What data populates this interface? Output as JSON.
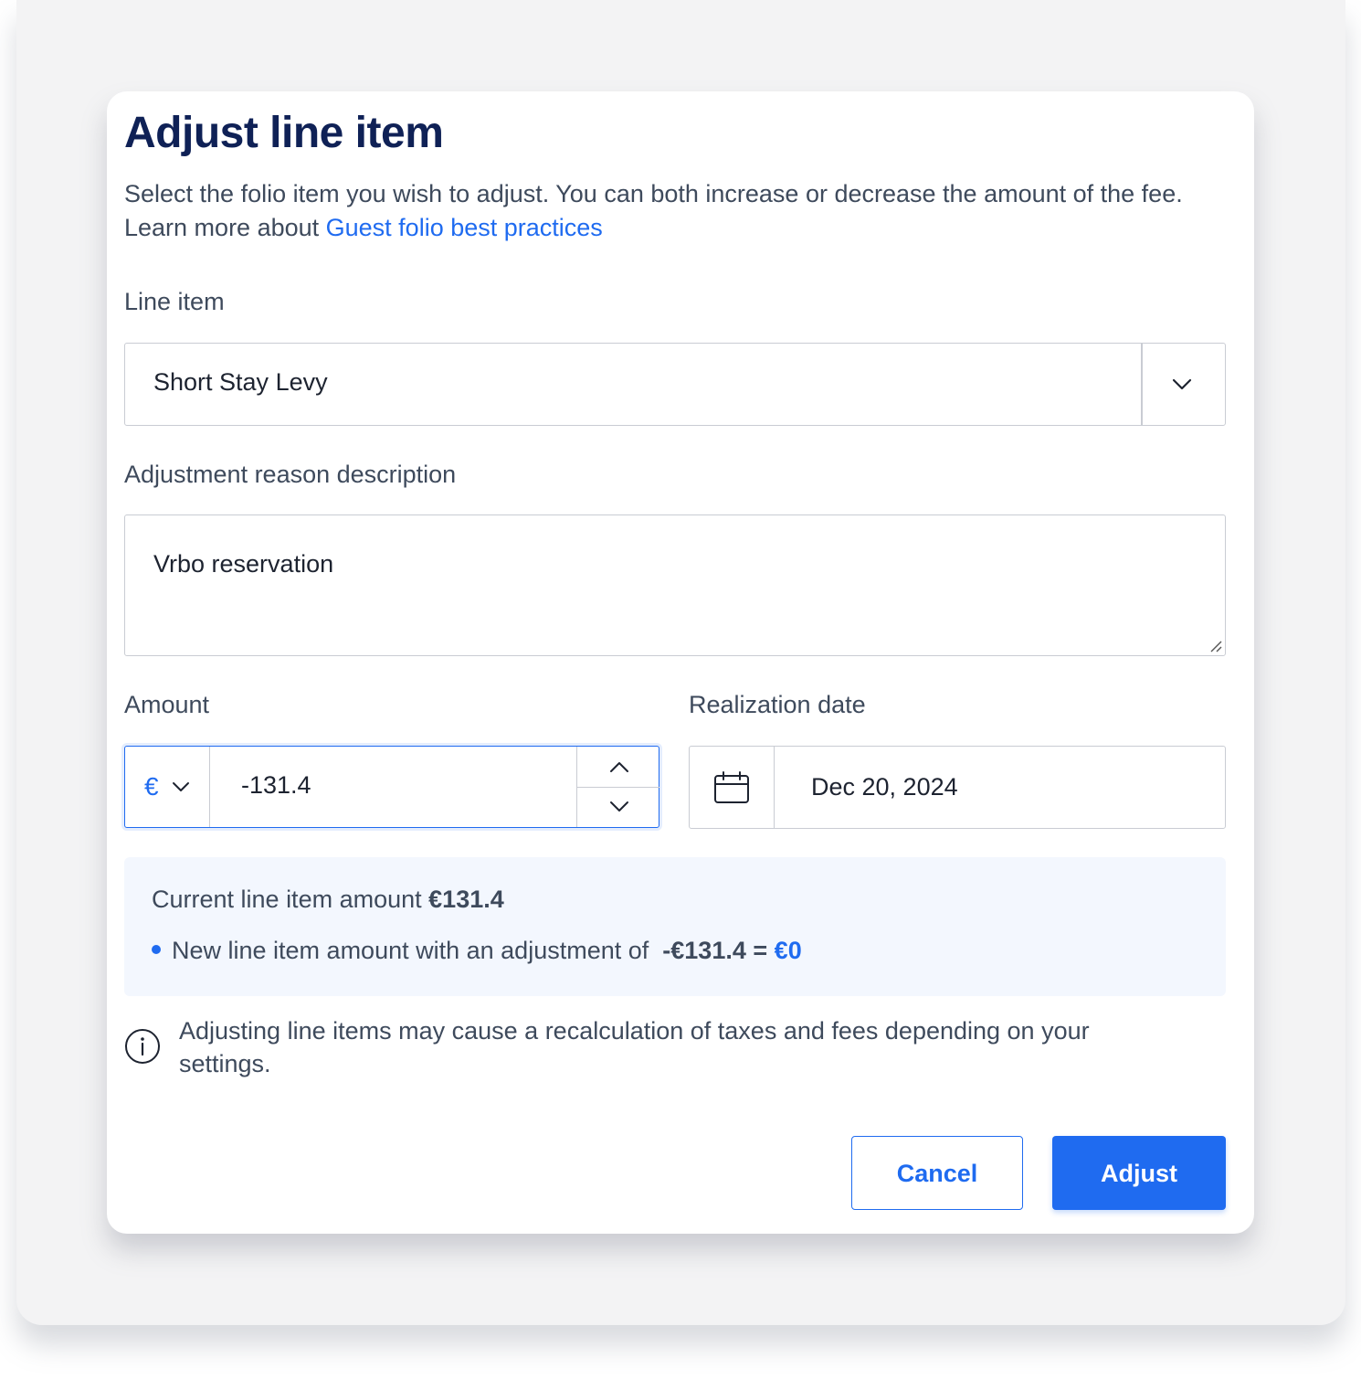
{
  "dialog": {
    "title": "Adjust line item",
    "description": "Select the folio item you wish to adjust. You can both increase or decrease the amount of the fee. Learn more about ",
    "description_link": "Guest folio best practices"
  },
  "line_item": {
    "label": "Line item",
    "selected": "Short Stay Levy"
  },
  "reason": {
    "label": "Adjustment reason description",
    "value": "Vrbo reservation"
  },
  "amount": {
    "label": "Amount",
    "currency_symbol": "€",
    "value": "-131.4"
  },
  "realization_date": {
    "label": "Realization date",
    "value": "Dec 20, 2024"
  },
  "summary": {
    "current_label": "Current line item amount",
    "current_value": "€131.4",
    "new_label": "New line item amount with an adjustment of",
    "adjustment_value": "-€131.4",
    "equals": "=",
    "new_value": "€0"
  },
  "note": {
    "text": "Adjusting line items may cause a recalculation of taxes and fees depending on your settings."
  },
  "buttons": {
    "cancel": "Cancel",
    "adjust": "Adjust"
  },
  "colors": {
    "primary": "#1f6bf0",
    "title": "#0f2156",
    "info_background": "#f3f7fe"
  }
}
